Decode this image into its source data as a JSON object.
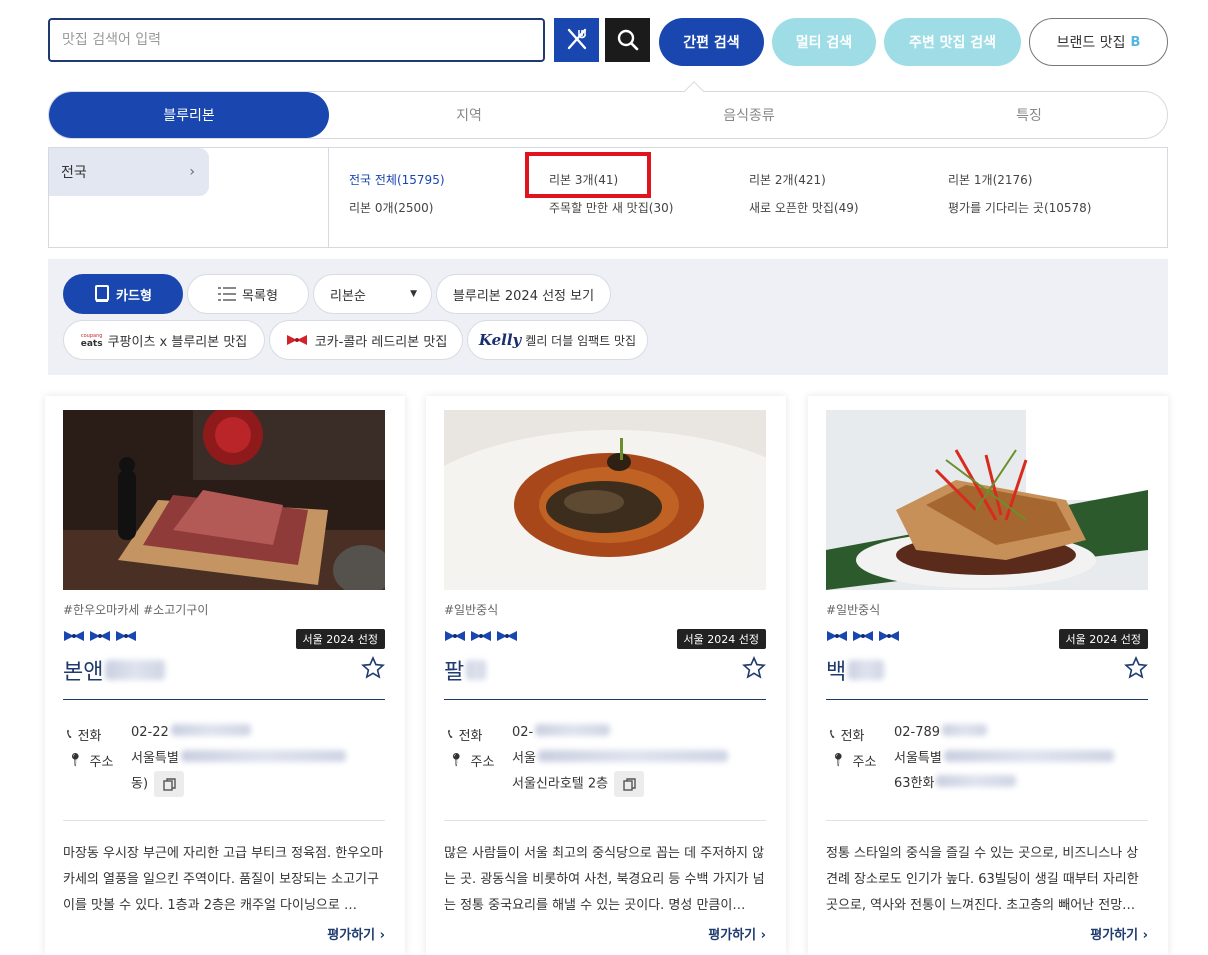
{
  "search": {
    "placeholder": "맛집 검색어 입력",
    "buttons": {
      "quick": "간편 검색",
      "multi": "멀티 검색",
      "nearby": "주변 맛집 검색",
      "brand": "브랜드 맛집",
      "brand_mark": "B"
    }
  },
  "tabs": [
    "블루리본",
    "지역",
    "음식종류",
    "특징"
  ],
  "filter": {
    "region": "전국",
    "options": [
      {
        "label": "전국 전체(15795)",
        "selected": true
      },
      {
        "label": "리본 3개(41)",
        "selected": false
      },
      {
        "label": "리본 2개(421)",
        "selected": false
      },
      {
        "label": "리본 1개(2176)",
        "selected": false
      },
      {
        "label": "리본 0개(2500)",
        "selected": false
      },
      {
        "label": "주목할 만한 새 맛집(30)",
        "selected": false
      },
      {
        "label": "새로 오픈한 맛집(49)",
        "selected": false
      },
      {
        "label": "평가를 기다리는 곳(10578)",
        "selected": false
      }
    ]
  },
  "view": {
    "card": "카드형",
    "list": "목록형",
    "sort": "리본순",
    "selection": "블루리본 2024 선정 보기",
    "coupang_logo_top": "coupang",
    "coupang_logo": "eats",
    "coupang": "쿠팡이츠 x 블루리본 맛집",
    "coke": "코카-콜라 레드리본 맛집",
    "kelly_logo": "Kelly",
    "kelly": "켈리 더블 임팩트 맛집"
  },
  "cards": [
    {
      "tags": "#한우오마카세  #소고기구이",
      "ribbons": 3,
      "badge": "서울 2024 선정",
      "name": "본앤",
      "phone_label": "전화",
      "phone": "02-22",
      "address_label": "주소",
      "address_line1": "서울특별",
      "address_line2": "동)",
      "description": "마장동 우시장 부근에 자리한 고급 부티크 정육점. 한우오마카세의 열풍을 일으킨 주역이다. 품질이 보장되는 소고기구이를 맛볼 수 있다. 1층과 2층은 캐주얼 다이닝으로 …",
      "evaluate": "평가하기"
    },
    {
      "tags": "#일반중식",
      "ribbons": 3,
      "badge": "서울 2024 선정",
      "name": "팔",
      "phone_label": "전화",
      "phone": "02-",
      "address_label": "주소",
      "address_line1": "서울",
      "address_line2": "서울신라호텔 2층",
      "description": "많은 사람들이 서울 최고의 중식당으로 꼽는 데 주저하지 않는 곳. 광동식을 비롯하여 사천, 북경요리 등 수백 가지가 넘는 정통 중국요리를 해낼 수 있는 곳이다. 명성 만큼이…",
      "evaluate": "평가하기"
    },
    {
      "tags": "#일반중식",
      "ribbons": 3,
      "badge": "서울 2024 선정",
      "name": "백",
      "phone_label": "전화",
      "phone": "02-789",
      "address_label": "주소",
      "address_line1": "서울특별",
      "address_line2": "63한화",
      "description": "정통 스타일의 중식을 즐길 수 있는 곳으로, 비즈니스나 상견례 장소로도 인기가 높다. 63빌딩이 생길 때부터 자리한 곳으로, 역사와 전통이 느껴진다. 초고층의 빼어난 전망…",
      "evaluate": "평가하기"
    }
  ],
  "colors": {
    "primary": "#1a46b0",
    "navy": "#1f3a6e",
    "light_pill": "#9fdde6",
    "highlight": "#e0141e"
  }
}
